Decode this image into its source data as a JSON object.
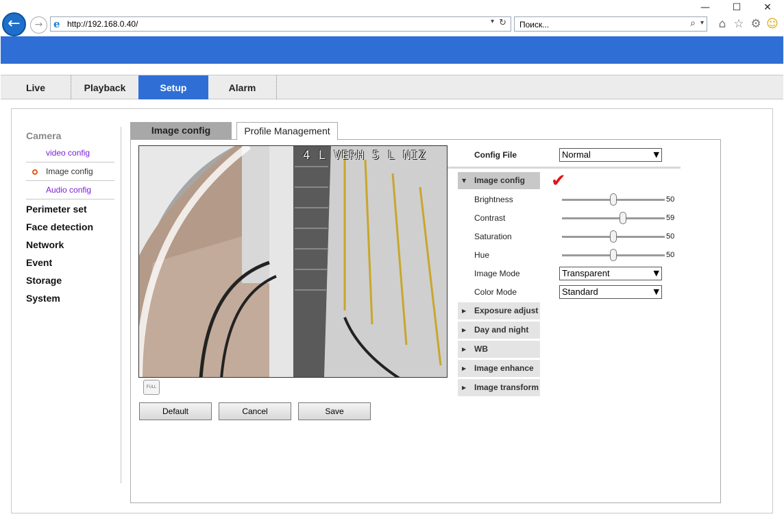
{
  "browser": {
    "url": "http://192.168.0.40/",
    "search_placeholder": "Поиск...",
    "controls": {
      "minimize": "—",
      "maximize": "☐",
      "close": "✕"
    },
    "icons": [
      "home-icon",
      "favorites-star-icon",
      "settings-gear-icon",
      "smiley-feedback-icon"
    ]
  },
  "colors": {
    "accent": "#2f6fd5",
    "check": "#e01515",
    "link": "#7b1fd6"
  },
  "nav": {
    "tabs": [
      "Live",
      "Playback",
      "Setup",
      "Alarm"
    ],
    "active": "Setup"
  },
  "sidebar": {
    "camera": "Camera",
    "camera_items": [
      "video config",
      "Image config",
      "Audio config"
    ],
    "active_item": "Image config",
    "categories": [
      "Perimeter set",
      "Face detection",
      "Network",
      "Event",
      "Storage",
      "System"
    ]
  },
  "content_tabs": {
    "active": "Image config",
    "other": "Profile Management"
  },
  "video": {
    "osd": "4 L VERH  5 L NIZ",
    "full_label": "FULL"
  },
  "buttons": {
    "default": "Default",
    "cancel": "Cancel",
    "save": "Save"
  },
  "settings": {
    "config_file_label": "Config File",
    "config_file_value": "Normal",
    "section_open": "Image config",
    "sliders": [
      {
        "label": "Brightness",
        "value": 50,
        "fraction": 0.5
      },
      {
        "label": "Contrast",
        "value": 59,
        "fraction": 0.59
      },
      {
        "label": "Saturation",
        "value": 50,
        "fraction": 0.5
      },
      {
        "label": "Hue",
        "value": 50,
        "fraction": 0.5
      }
    ],
    "image_mode_label": "Image Mode",
    "image_mode_value": "Transparent",
    "color_mode_label": "Color Mode",
    "color_mode_value": "Standard",
    "sections_collapsed": [
      "Exposure adjust",
      "Day and night",
      "WB",
      "Image enhance",
      "Image transform"
    ]
  }
}
